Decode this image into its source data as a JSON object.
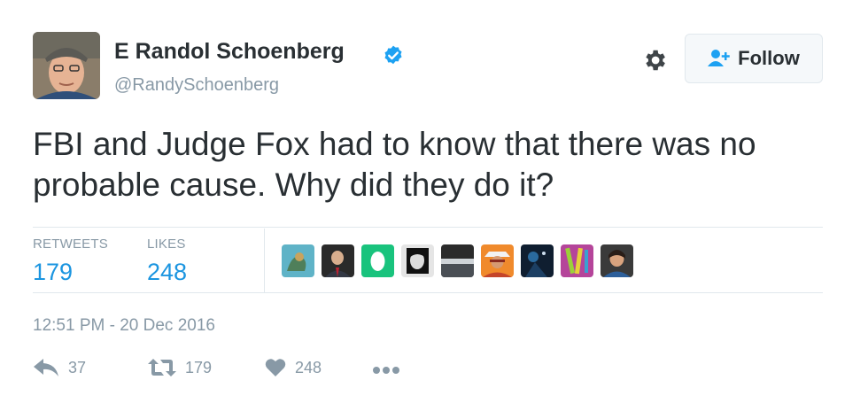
{
  "user": {
    "display_name": "E Randol Schoenberg",
    "handle": "@RandySchoenberg",
    "verified": true
  },
  "follow": {
    "label": "Follow"
  },
  "tweet": {
    "text": "FBI and Judge Fox had to know that there was no probable cause.  Why did they do it?"
  },
  "stats": {
    "retweets_label": "RETWEETS",
    "retweets_count": "179",
    "likes_label": "LIKES",
    "likes_count": "248"
  },
  "likers": [
    {
      "icon": "liker-avatar-1"
    },
    {
      "icon": "liker-avatar-2"
    },
    {
      "icon": "liker-avatar-3"
    },
    {
      "icon": "liker-avatar-4"
    },
    {
      "icon": "liker-avatar-5"
    },
    {
      "icon": "liker-avatar-6"
    },
    {
      "icon": "liker-avatar-7"
    },
    {
      "icon": "liker-avatar-8"
    },
    {
      "icon": "liker-avatar-9"
    }
  ],
  "timestamp": "12:51 PM - 20 Dec 2016",
  "actions": {
    "reply_count": "37",
    "retweet_count": "179",
    "like_count": "248"
  },
  "colors": {
    "link_blue": "#1b95e0",
    "muted_gray": "#8899a6",
    "verified_blue": "#1da1f2",
    "text_dark": "#292f33"
  }
}
